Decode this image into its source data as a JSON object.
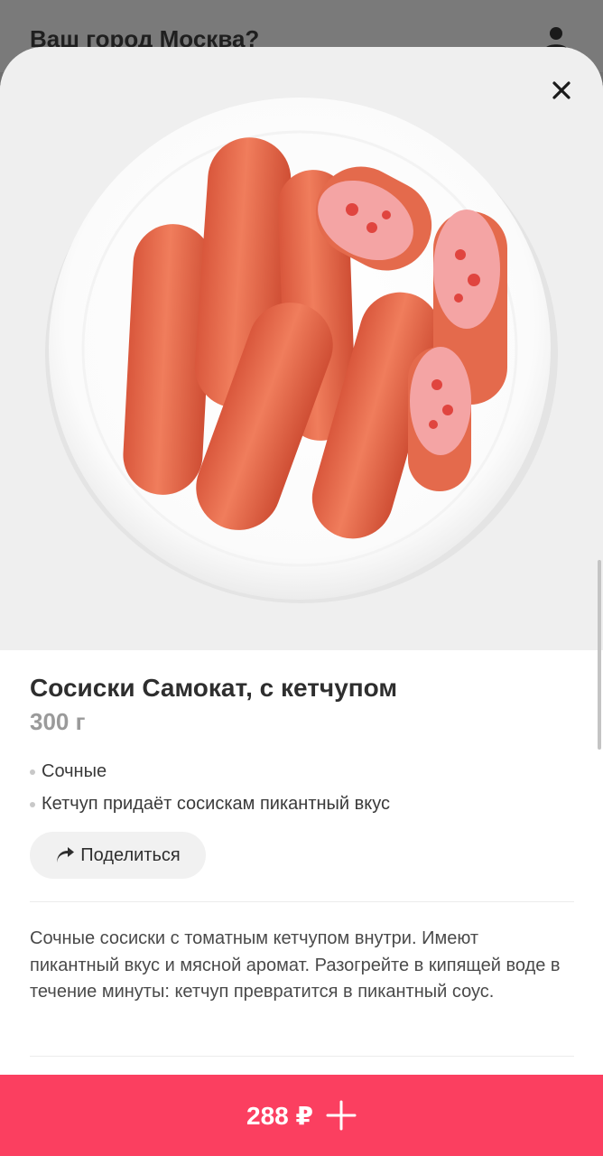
{
  "header": {
    "city_prompt": "Ваш город Москва?",
    "profile_icon": "user-icon"
  },
  "product": {
    "title": "Сосиски Самокат, с кетчупом",
    "weight": "300 г",
    "features": [
      "Сочные",
      "Кетчуп придаёт сосискам пикантный вкус"
    ],
    "share_label": "Поделиться",
    "description": "Сочные сосиски с томатным кетчупом внутри. Имеют пикантный вкус и мясной аромат. Разогрейте в кипящей воде в течение минуты: кетчуп превратится в пикантный соус.",
    "image_icon": "product-photo"
  },
  "actions": {
    "close_icon": "close-icon",
    "price": "288 ₽",
    "add_icon": "plus-icon"
  },
  "colors": {
    "accent": "#fb3f60",
    "title": "#2e2e2e",
    "weight": "#9a9a9a"
  }
}
